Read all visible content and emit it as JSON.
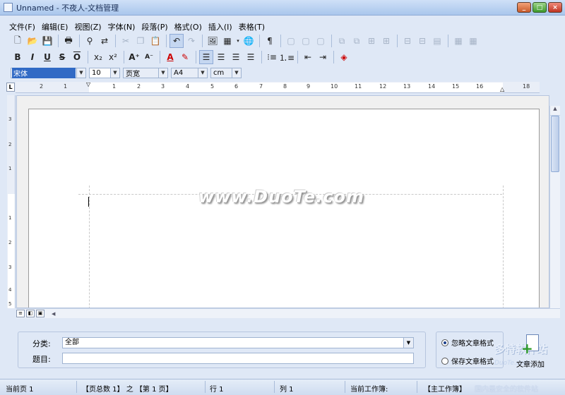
{
  "window": {
    "title": "Unnamed - 不夜人-文档管理"
  },
  "menu": [
    "文件(F)",
    "编辑(E)",
    "视图(Z)",
    "字体(N)",
    "段落(P)",
    "格式(O)",
    "插入(I)",
    "表格(T)"
  ],
  "format_bar": {
    "font_name": "宋体",
    "font_size": "10",
    "zoom": "页宽",
    "paper": "A4",
    "unit": "cm"
  },
  "ruler": {
    "h_ticks": [
      "2",
      "1",
      "1",
      "2",
      "3",
      "4",
      "5",
      "6",
      "7",
      "8",
      "9",
      "10",
      "11",
      "12",
      "13",
      "14",
      "15",
      "16",
      "18"
    ],
    "v_ticks": [
      "3",
      "2",
      "1",
      "1",
      "2",
      "3",
      "4",
      "5"
    ]
  },
  "document": {
    "watermark": "www.DuoTe.com"
  },
  "form": {
    "category_label": "分类:",
    "category_value": "全部",
    "title_label": "题目:",
    "title_value": ""
  },
  "options": {
    "ignore_format": "忽略文章格式",
    "save_format": "保存文章格式",
    "selected": "ignore_format"
  },
  "add_button": {
    "label": "文章添加"
  },
  "logo": {
    "name": "多特软件站",
    "sub": "DuoTe.com"
  },
  "status": {
    "current_page": "当前页 1",
    "total_pages": "【页总数 1】 之 【第 1 页】",
    "row": "行 1",
    "col": "列 1",
    "workbook_label": "当前工作簿:",
    "workbook_value": "【主工作簿】",
    "watermark": "国内最安全的软件站"
  }
}
